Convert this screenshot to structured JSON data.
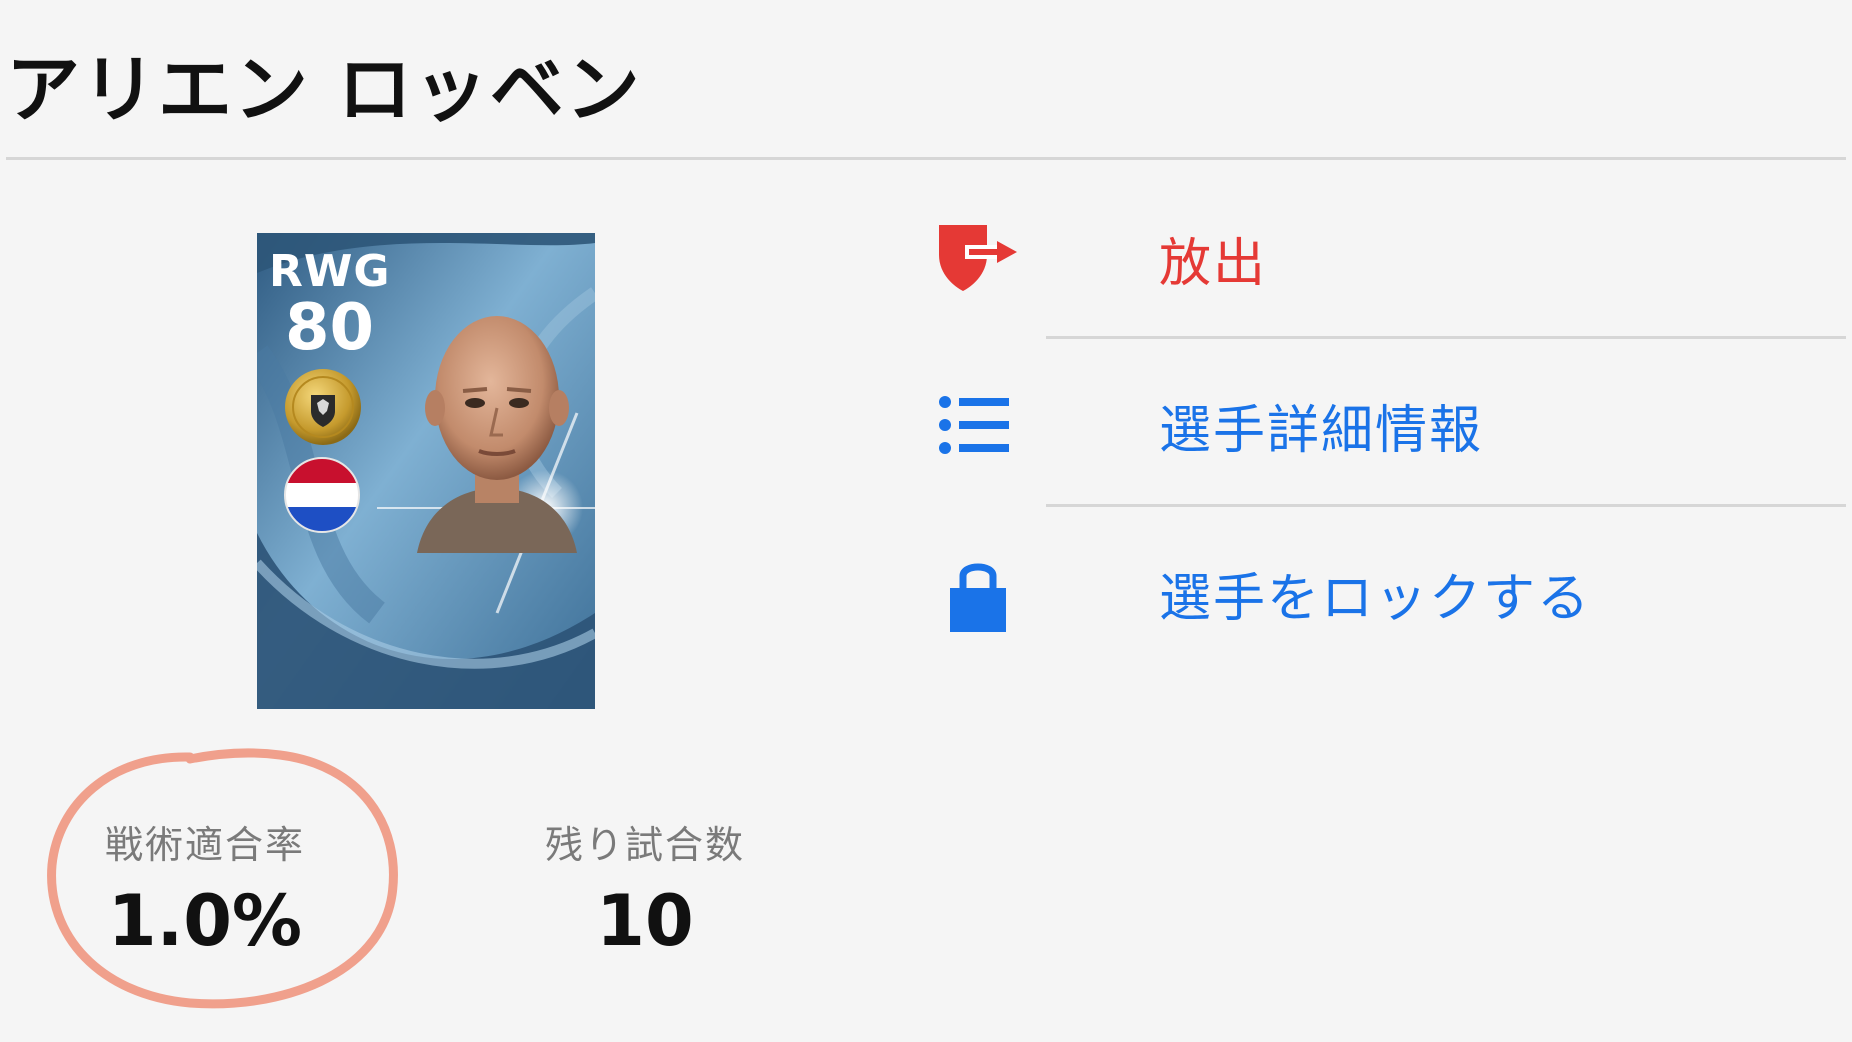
{
  "header": {
    "player_name": "アリエン ロッベン"
  },
  "card": {
    "position": "RWG",
    "rating": "80"
  },
  "actions": {
    "release": "放出",
    "details": "選手詳細情報",
    "lock": "選手をロックする"
  },
  "stats": {
    "tactic_fit_label": "戦術適合率",
    "tactic_fit_value": "1.0%",
    "remaining_matches_label": "残り試合数",
    "remaining_matches_value": "10"
  },
  "colors": {
    "background": "#f5f5f5",
    "release_red": "#e53935",
    "action_blue": "#1a73e8",
    "annotation_circle": "#f0a08c"
  },
  "icons": {
    "release": "exit-shield-icon",
    "details": "list-icon",
    "lock": "lock-icon",
    "badge": "club-crest-icon",
    "flag": "netherlands-flag-icon"
  }
}
